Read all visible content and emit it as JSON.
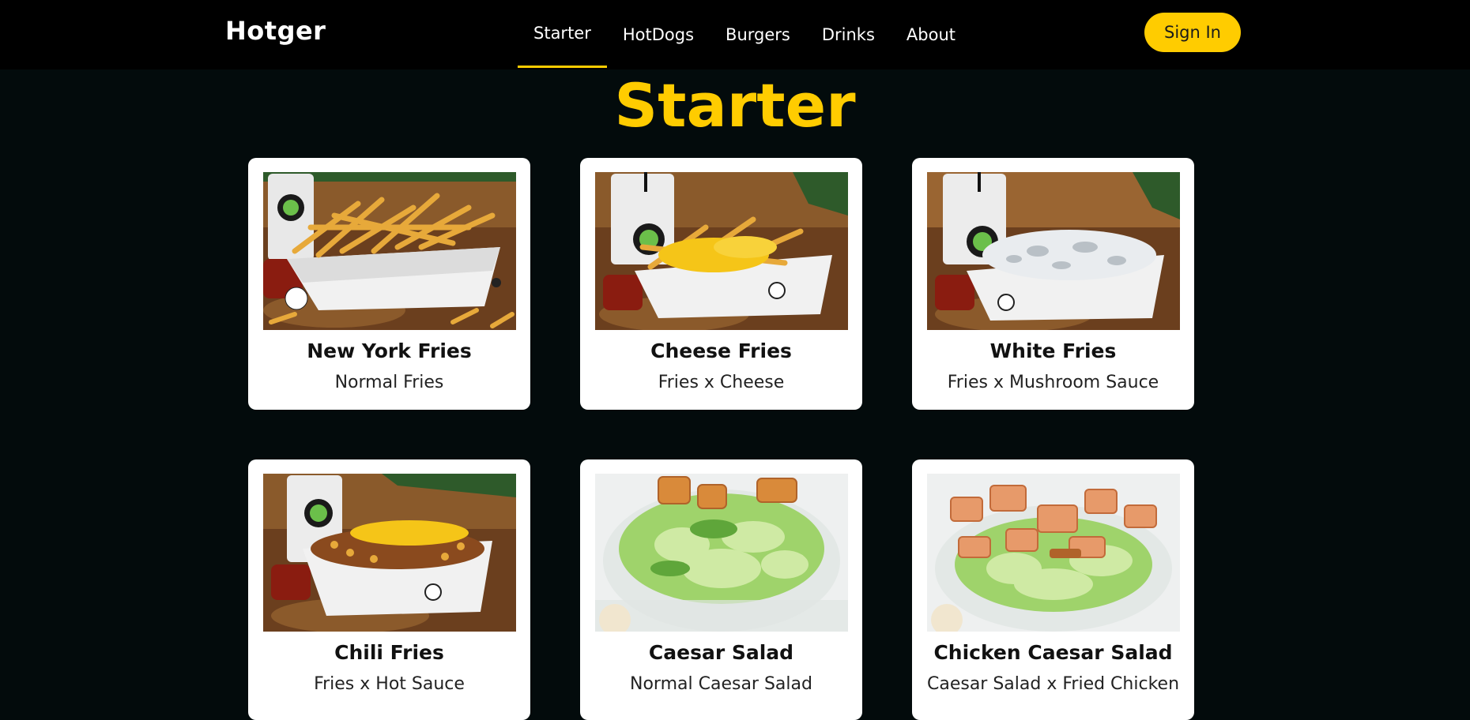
{
  "brand": "Hotger",
  "nav": {
    "links": [
      "Starter",
      "HotDogs",
      "Burgers",
      "Drinks",
      "About"
    ],
    "active": "Starter",
    "signin_label": "Sign In"
  },
  "section_title": "Starter",
  "menu_items": [
    {
      "name": "New York Fries",
      "desc": "Normal Fries"
    },
    {
      "name": "Cheese Fries",
      "desc": "Fries x Cheese"
    },
    {
      "name": "White Fries",
      "desc": "Fries x Mushroom Sauce"
    },
    {
      "name": "Chili Fries",
      "desc": "Fries x Hot Sauce"
    },
    {
      "name": "Caesar Salad",
      "desc": "Normal Caesar Salad"
    },
    {
      "name": "Chicken Caesar Salad",
      "desc": "Caesar Salad x Fried Chicken"
    }
  ],
  "colors": {
    "accent": "#ffcc00",
    "background": "#030b0c",
    "navbar": "#000000",
    "card": "#ffffff"
  }
}
